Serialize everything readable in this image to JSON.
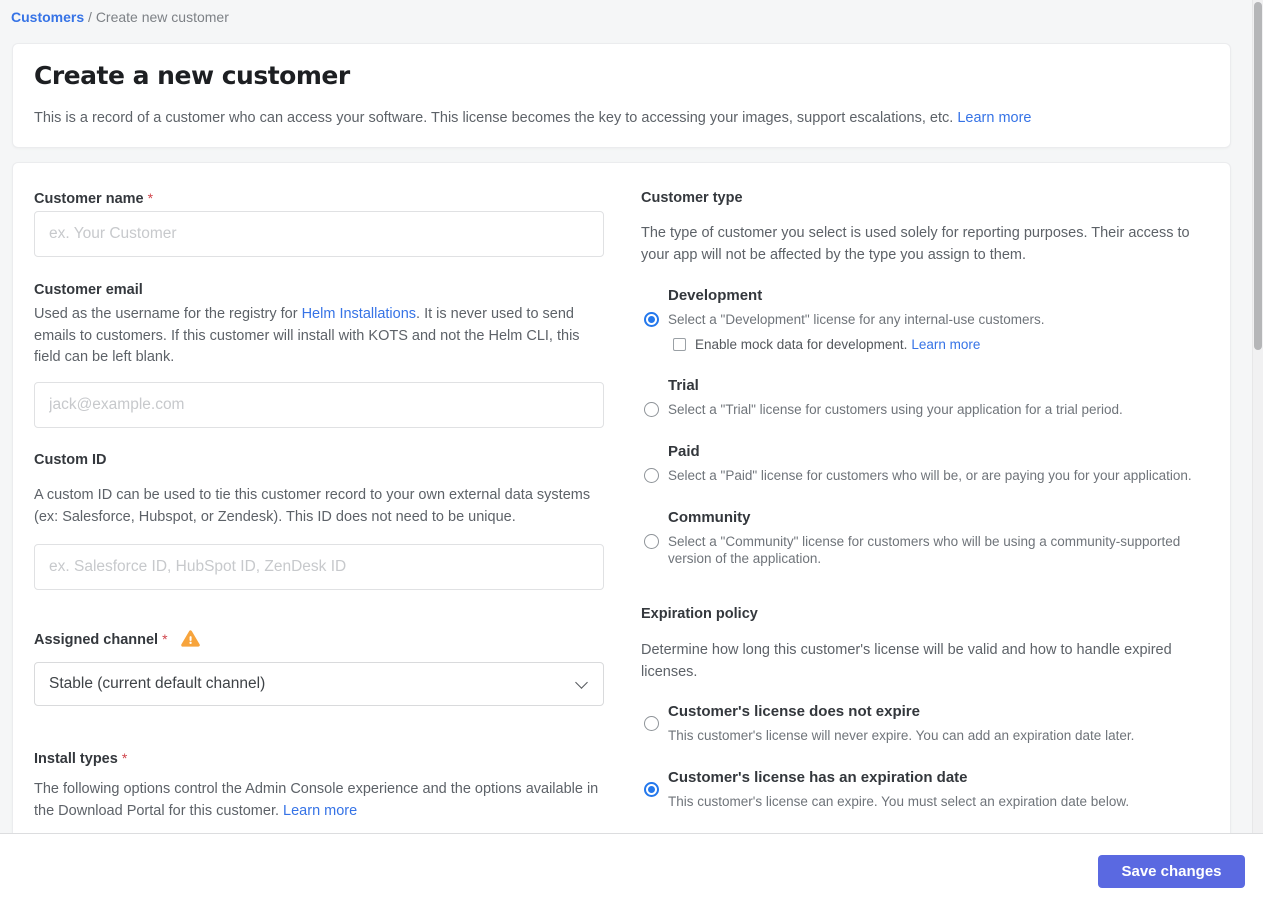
{
  "breadcrumb": {
    "link": "Customers",
    "separator": "/",
    "current": "Create new customer"
  },
  "header": {
    "title": "Create a new customer",
    "description": "This is a record of a customer who can access your software. This license becomes the key to accessing your images, support escalations, etc.",
    "learn_more": "Learn more"
  },
  "form": {
    "customer_name": {
      "label": "Customer name",
      "required": "*",
      "placeholder": "ex. Your Customer"
    },
    "customer_email": {
      "label": "Customer email",
      "description_pre": "Used as the username for the registry for ",
      "description_link": "Helm Installations",
      "description_post": ". It is never used to send emails to customers. If this customer will install with KOTS and not the Helm CLI, this field can be left blank.",
      "placeholder": "jack@example.com"
    },
    "custom_id": {
      "label": "Custom ID",
      "description": "A custom ID can be used to tie this customer record to your own external data systems (ex: Salesforce, Hubspot, or Zendesk). This ID does not need to be unique.",
      "placeholder": "ex. Salesforce ID, HubSpot ID, ZenDesk ID"
    },
    "assigned_channel": {
      "label": "Assigned channel",
      "required": "*",
      "has_warning": true,
      "selected_option": "Stable (current default channel)"
    },
    "install_types": {
      "label": "Install types",
      "required": "*",
      "description": "The following options control the Admin Console experience and the options available in the Download Portal for this customer.",
      "learn_more": "Learn more"
    },
    "customer_type": {
      "label": "Customer type",
      "description": "The type of customer you select is used solely for reporting purposes. Their access to your app will not be affected by the type you assign to them.",
      "options": [
        {
          "name": "Development",
          "description": "Select a \"Development\" license for any internal-use customers.",
          "selected": true
        },
        {
          "name": "Trial",
          "description": "Select a \"Trial\" license for customers using your application for a trial period.",
          "selected": false
        },
        {
          "name": "Paid",
          "description": "Select a \"Paid\" license for customers who will be, or are paying you for your application.",
          "selected": false
        },
        {
          "name": "Community",
          "description": "Select a \"Community\" license for customers who will be using a community-supported version of the application.",
          "selected": false
        }
      ],
      "mock_data_checkbox": {
        "label": "Enable mock data for development.",
        "learn_more": "Learn more",
        "checked": false
      }
    },
    "expiration_policy": {
      "label": "Expiration policy",
      "description": "Determine how long this customer's license will be valid and how to handle expired licenses.",
      "options": [
        {
          "name": "Customer's license does not expire",
          "description": "This customer's license will never expire. You can add an expiration date later.",
          "selected": false
        },
        {
          "name": "Customer's license has an expiration date",
          "description": "This customer's license can expire. You must select an expiration date below.",
          "selected": true
        }
      ]
    }
  },
  "footer": {
    "save_button": "Save changes"
  },
  "colors": {
    "link_blue": "#3673e6",
    "radio_blue": "#2478ec",
    "button_indigo": "#5a69e1",
    "warning_orange": "#f7a43c",
    "required_red": "#d0454c"
  }
}
